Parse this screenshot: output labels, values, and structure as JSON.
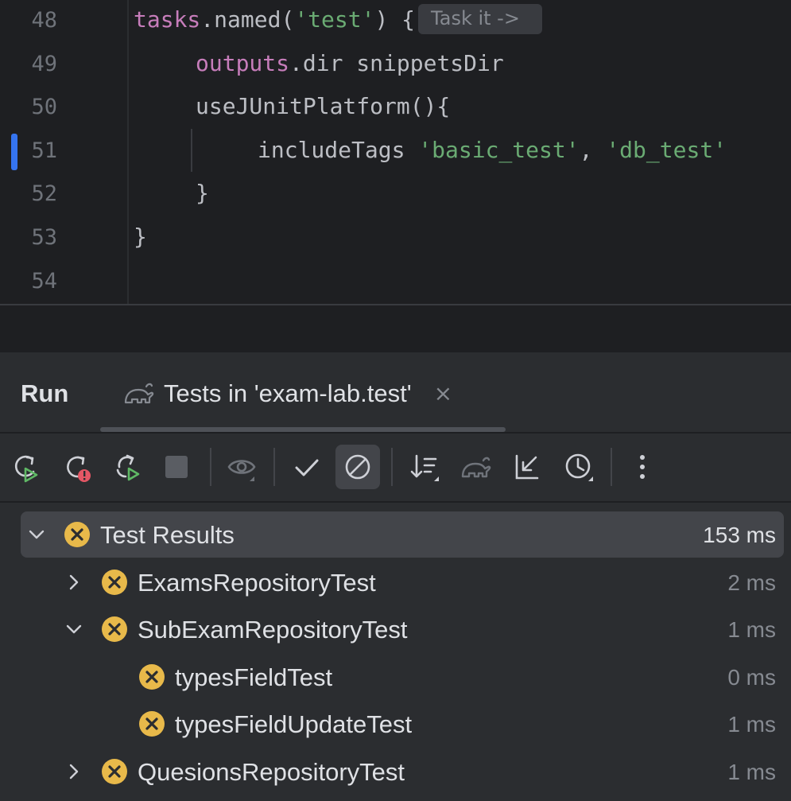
{
  "editor": {
    "lines": [
      {
        "num": "48",
        "indent": 0,
        "segments": [
          {
            "t": "tasks",
            "c": "kw"
          },
          {
            "t": ".named(",
            "c": ""
          },
          {
            "t": "'test'",
            "c": "str"
          },
          {
            "t": ") {",
            "c": ""
          }
        ],
        "hint": "Task it ->"
      },
      {
        "num": "49",
        "indent": 1,
        "segments": [
          {
            "t": "outputs",
            "c": "kw"
          },
          {
            "t": ".dir snippetsDir",
            "c": ""
          }
        ]
      },
      {
        "num": "50",
        "indent": 1,
        "segments": [
          {
            "t": "useJUnitPlatform(){",
            "c": ""
          }
        ]
      },
      {
        "num": "51",
        "indent": 2,
        "segments": [
          {
            "t": "includeTags ",
            "c": ""
          },
          {
            "t": "'basic_test'",
            "c": "str"
          },
          {
            "t": ", ",
            "c": ""
          },
          {
            "t": "'db_test'",
            "c": "str"
          }
        ]
      },
      {
        "num": "52",
        "indent": 1,
        "segments": [
          {
            "t": "}",
            "c": ""
          }
        ]
      },
      {
        "num": "53",
        "indent": 0,
        "segments": [
          {
            "t": "}",
            "c": ""
          }
        ]
      },
      {
        "num": "54",
        "indent": 0,
        "segments": []
      }
    ]
  },
  "run": {
    "title": "Run",
    "tab_label": "Tests in 'exam-lab.test'",
    "tab_close": "×"
  },
  "toolbar": {
    "buttons": [
      {
        "name": "rerun-icon",
        "kind": "rerun",
        "interactable": true
      },
      {
        "name": "rerun-failed-icon",
        "kind": "rerun-failed",
        "interactable": true
      },
      {
        "name": "toggle-auto-test-icon",
        "kind": "auto",
        "interactable": true
      },
      {
        "name": "stop-icon",
        "kind": "stop",
        "interactable": false
      },
      {
        "sep": true
      },
      {
        "name": "show-passed-eye-icon",
        "kind": "eye",
        "interactable": false
      },
      {
        "sep": true
      },
      {
        "name": "show-passed-check-icon",
        "kind": "check",
        "interactable": true
      },
      {
        "name": "show-ignored-icon",
        "kind": "ignored",
        "interactable": true,
        "active": true
      },
      {
        "sep": true
      },
      {
        "name": "sort-icon",
        "kind": "sort",
        "interactable": true
      },
      {
        "name": "gradle-icon",
        "kind": "gradle",
        "interactable": false
      },
      {
        "name": "collapse-icon",
        "kind": "collapse",
        "interactable": true
      },
      {
        "name": "history-icon",
        "kind": "history",
        "interactable": true
      },
      {
        "sep": true
      },
      {
        "name": "more-options-icon",
        "kind": "more",
        "interactable": true
      }
    ]
  },
  "tree": {
    "rows": [
      {
        "label": "Test Results",
        "time": "153 ms",
        "level": 0,
        "chevron": "down",
        "selected": true
      },
      {
        "label": "ExamsRepositoryTest",
        "time": "2 ms",
        "level": 1,
        "chevron": "right"
      },
      {
        "label": "SubExamRepositoryTest",
        "time": "1 ms",
        "level": 1,
        "chevron": "down"
      },
      {
        "label": "typesFieldTest",
        "time": "0 ms",
        "level": 2,
        "chevron": ""
      },
      {
        "label": "typesFieldUpdateTest",
        "time": "1 ms",
        "level": 2,
        "chevron": ""
      },
      {
        "label": "QuesionsRepositoryTest",
        "time": "1 ms",
        "level": 1,
        "chevron": "right"
      }
    ]
  },
  "colors": {
    "fail": "#e8b94a",
    "accent": "#3574f0",
    "run_green": "#5fb865",
    "error_red": "#e55765"
  }
}
